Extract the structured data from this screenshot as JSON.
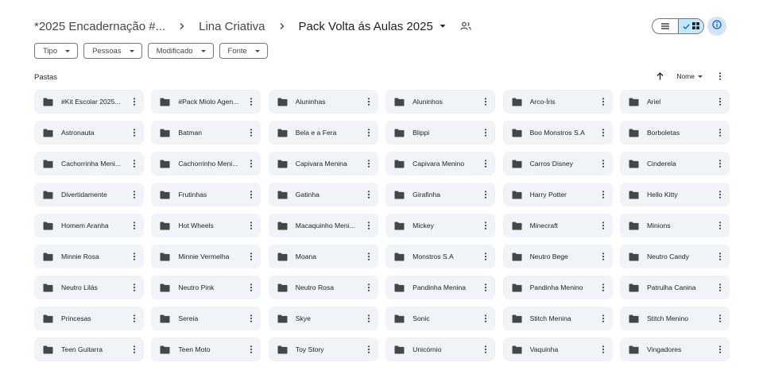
{
  "breadcrumb": {
    "items": [
      "*2025 Encadernação #...",
      "Lina Criativa"
    ],
    "current": "Pack Volta ás Aulas 2025"
  },
  "icons": {
    "separator": "chevron-right-icon",
    "share": "shared-folder-icon",
    "list_view": "list-view-icon",
    "grid_view": "grid-view-icon",
    "info": "info-icon",
    "folder": "folder-icon",
    "more": "more-vert-icon",
    "sort": "arrow-up-icon"
  },
  "colors": {
    "folder_bg": "#f0f4f9",
    "toggle_active": "#c2e7ff",
    "info_bg": "#d3e3fd"
  },
  "filters": [
    "Tipo",
    "Pessoas",
    "Modificado",
    "Fonte"
  ],
  "section": {
    "title": "Pastas",
    "sort_label": "Nome"
  },
  "folders": [
    "#Kit Escolar 2025...",
    "#Pack Miolo Agen...",
    "Aluninhas",
    "Aluninhos",
    "Arco-Íris",
    "Ariel",
    "Astronauta",
    "Batman",
    "Bela e a Fera",
    "Blippi",
    "Boo Monstros S.A",
    "Borboletas",
    "Cachorrinha Meni...",
    "Cachorrinho Meni...",
    "Capivara Menina",
    "Capivara Menino",
    "Carros Disney",
    "Cinderela",
    "Divertidamente",
    "Frutinhas",
    "Gatinha",
    "Girafinha",
    "Harry Potter",
    "Hello Kitty",
    "Homem Aranha",
    "Hot Wheels",
    "Macaquinho Meni...",
    "Mickey",
    "Minecraft",
    "Minions",
    "Minnie Rosa",
    "Minnie Vermelha",
    "Moana",
    "Monstros S.A",
    "Neutro Bege",
    "Neutro Candy",
    "Neutro Lilás",
    "Neutro Pink",
    "Neutro Rosa",
    "Pandinha Menina",
    "Pandinha Menino",
    "Patrulha Canina",
    "Princesas",
    "Sereia",
    "Skye",
    "Sonic",
    "Stitch Menina",
    "Stitch Menino",
    "Teen Guitarra",
    "Teen Moto",
    "Toy Story",
    "Unicórnio",
    "Vaquinha",
    "Vingadores"
  ]
}
